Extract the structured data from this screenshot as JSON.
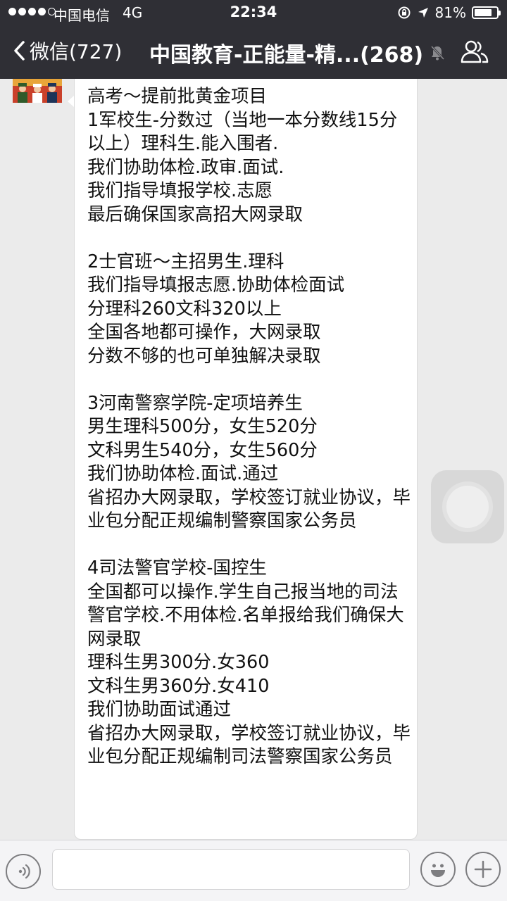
{
  "status_bar": {
    "carrier": "中国电信",
    "network": "4G",
    "time": "22:34",
    "battery_percent": "81%",
    "battery_level": 0.81
  },
  "nav": {
    "back_label": "微信(727)",
    "title": "中国教育-正能量-精...(268)"
  },
  "message": {
    "text": "高考～提前批黄金项目\n1军校生-分数过（当地一本分数线15分以上）理科生.能入围者.\n我们协助体检.政审.面试.\n我们指导填报学校.志愿\n最后确保国家高招大网录取\n\n2士官班～主招男生.理科\n我们指导填报志愿.协助体检面试\n分理科260文科320以上\n全国各地都可操作，大网录取\n分数不够的也可单独解决录取\n\n3河南警察学院-定项培养生\n男生理科500分，女生520分\n文科男生540分，女生560分\n我们协助体检.面试.通过\n省招办大网录取，学校签订就业协议，毕业包分配正规编制警察国家公务员\n\n4司法警官学校-国控生\n全国都可以操作.学生自己报当地的司法警官学校.不用体检.名单报给我们确保大网录取\n理科生男300分.女360\n文科生男360分.女410\n我们协助面试通过\n省招办大网录取，学校签订就业协议，毕业包分配正规编制司法警察国家公务员"
  },
  "input": {
    "value": "",
    "placeholder": ""
  },
  "icons": {
    "back": "chevron-left-icon",
    "mute": "mute-bell-icon",
    "contacts": "group-members-icon",
    "voice": "voice-icon",
    "emoji": "emoji-icon",
    "plus": "plus-icon",
    "lock": "rotation-lock-icon",
    "location": "location-arrow-icon"
  },
  "colors": {
    "header_bg": "#2f2f35",
    "chat_bg": "#ebebeb",
    "bubble_bg": "#ffffff"
  }
}
